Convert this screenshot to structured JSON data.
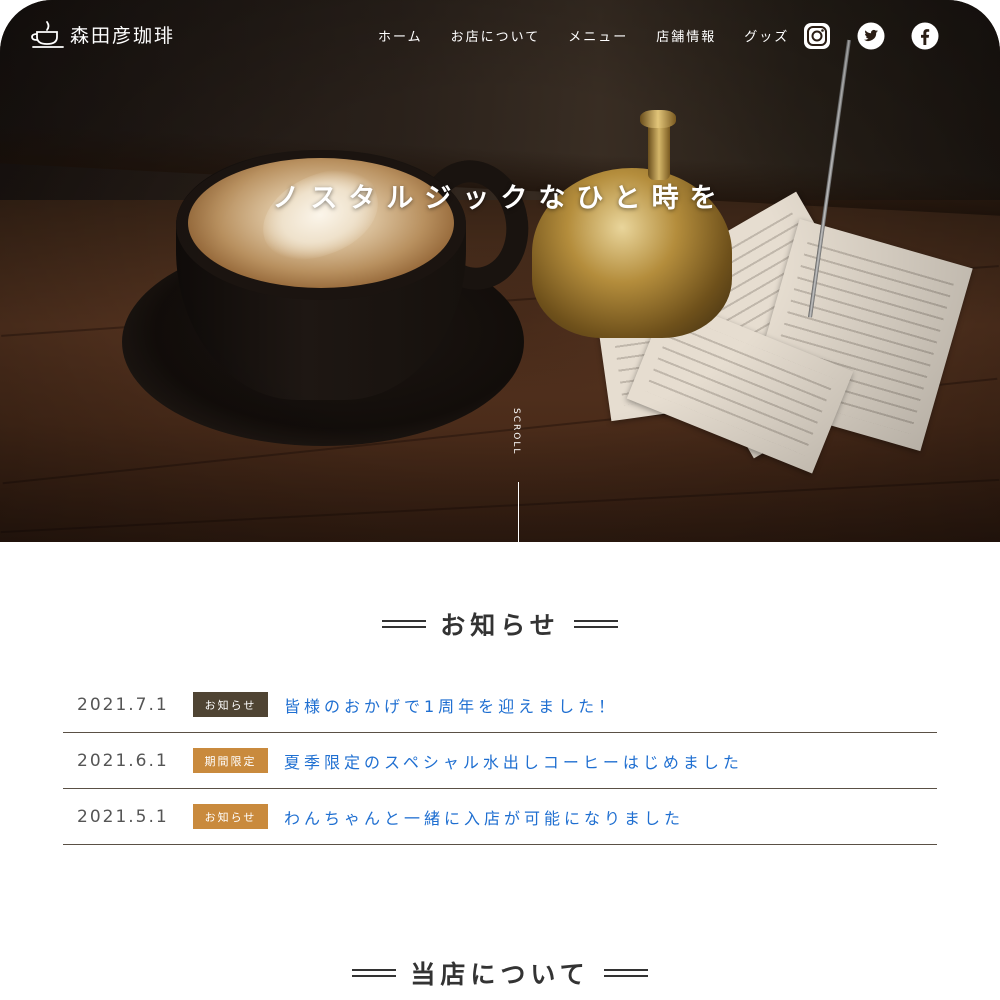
{
  "brand": {
    "logo_text": "森田彦珈琲"
  },
  "nav": {
    "items": [
      "ホーム",
      "お店について",
      "メニュー",
      "店舗情報",
      "グッズ"
    ]
  },
  "social": {
    "instagram_icon": "instagram-icon",
    "twitter_icon": "twitter-icon",
    "facebook_icon": "facebook-icon"
  },
  "hero": {
    "title": "ノスタルジックなひと時を",
    "scroll_label": "SCROLL"
  },
  "news": {
    "heading": "お知らせ",
    "items": [
      {
        "date": "2021.7.1",
        "badge": "お知らせ",
        "badge_color": "#4f4433",
        "text": "皆様のおかげで1周年を迎えました！"
      },
      {
        "date": "2021.6.1",
        "badge": "期間限定",
        "badge_color": "#c98a3d",
        "text": "夏季限定のスペシャル水出しコーヒーはじめました"
      },
      {
        "date": "2021.5.1",
        "badge": "お知らせ",
        "badge_color": "#c98a3d",
        "text": "わんちゃんと一緒に入店が可能になりました"
      }
    ]
  },
  "about": {
    "heading": "当店について"
  },
  "colors": {
    "link": "#1f6fd1",
    "badge_dark": "#4f4433",
    "badge_orange": "#c98a3d"
  }
}
